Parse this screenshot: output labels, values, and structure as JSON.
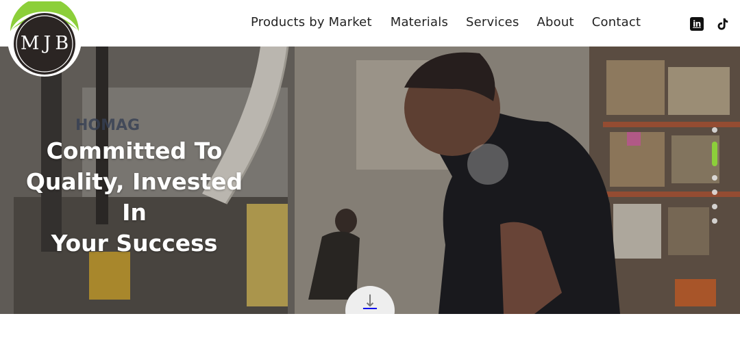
{
  "brand": {
    "logo_text": "MJB",
    "accent": "#8ccf3a",
    "dark": "#2b2523"
  },
  "nav": {
    "items": [
      {
        "label": "Products by Market"
      },
      {
        "label": "Materials"
      },
      {
        "label": "Services"
      },
      {
        "label": "About"
      },
      {
        "label": "Contact"
      }
    ]
  },
  "social": {
    "linkedin_icon": "linkedin-icon",
    "tiktok_icon": "tiktok-icon",
    "linkedin_text": "in"
  },
  "hero": {
    "title_lines": [
      "Committed To",
      "Quality, Invested In",
      "Your Success"
    ],
    "machine_label": "HOMAG",
    "slides_total": 7,
    "active_slide": 2,
    "scroll_icon": "arrow-down-icon"
  }
}
